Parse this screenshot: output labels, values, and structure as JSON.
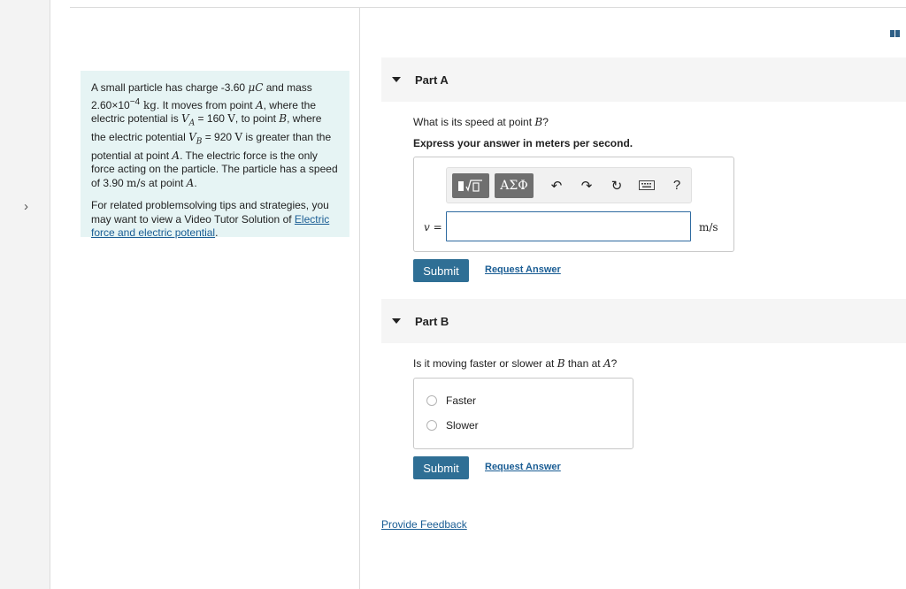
{
  "intro": {
    "p1_a": "A small particle has charge -3.60 ",
    "p1_unit_charge": "μC",
    "p1_b": " and mass 2.60×10",
    "p1_exp": "−4",
    "p1_unit_mass": " kg",
    "p1_c": ". It moves from point ",
    "p1_A1": "A",
    "p1_d": ", where the electric potential is ",
    "p1_VA": "V",
    "p1_VA_sub": "A",
    "p1_e": " = 160 ",
    "p1_V1": "V",
    "p1_f": ", to point ",
    "p1_B": "B",
    "p1_g": ", where the electric potential ",
    "p1_VB": "V",
    "p1_VB_sub": "B",
    "p1_h": " = 920 ",
    "p1_V2": "V",
    "p1_i": " is greater than the potential at point ",
    "p1_A2": "A",
    "p1_j": ". The electric force is the only force acting on the particle. The particle has a speed of 3.90 ",
    "p1_ms": "m/s",
    "p1_k": " at point ",
    "p1_A3": "A",
    "p1_l": ".",
    "p2_text": "For related problemsolving tips and strategies, you may want to view a Video Tutor Solution of ",
    "p2_link": "Electric force and electric potential",
    "p2_end": "."
  },
  "partA": {
    "title": "Part A",
    "question_a": "What is its speed at point ",
    "question_var": "B",
    "question_b": "?",
    "instruction": "Express your answer in meters per second.",
    "toolbar": {
      "templates_icon": "templates-icon",
      "greek": "ΑΣΦ",
      "undo": "↶",
      "redo": "↷",
      "reset": "↻",
      "keyboard_icon": "keyboard-icon",
      "help": "?"
    },
    "variable": "v =",
    "answer_value": "",
    "unit": "m/s",
    "submit": "Submit",
    "request": "Request Answer"
  },
  "partB": {
    "title": "Part B",
    "question_a": "Is it moving faster or slower at ",
    "question_var1": "B",
    "question_b": " than at ",
    "question_var2": "A",
    "question_c": "?",
    "options": [
      "Faster",
      "Slower"
    ],
    "submit": "Submit",
    "request": "Request Answer"
  },
  "feedback": "Provide Feedback",
  "colors": {
    "accent": "#2f6f95",
    "link": "#1a5d94",
    "intro_bg": "#e6f4f4"
  }
}
